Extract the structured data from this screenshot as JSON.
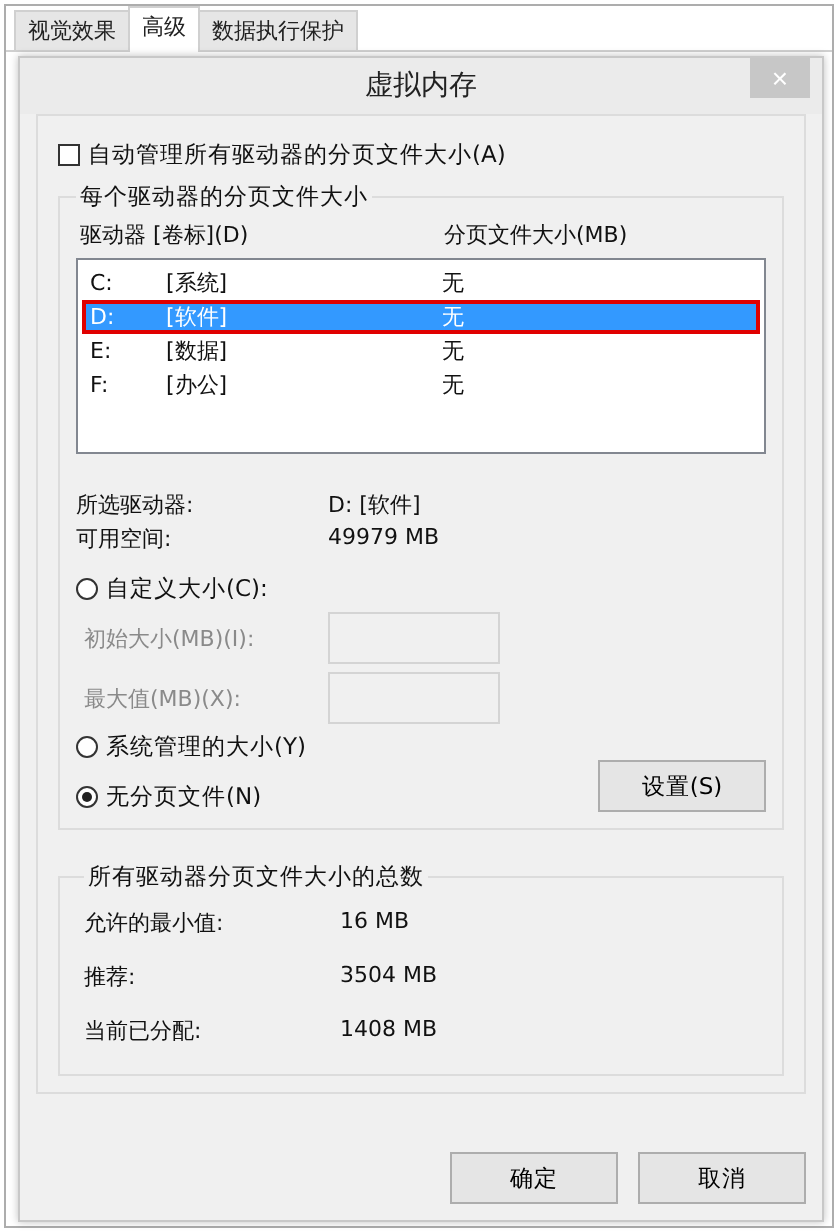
{
  "background_tabs": [
    {
      "label": "视觉效果",
      "selected": false
    },
    {
      "label": "高级",
      "selected": true
    },
    {
      "label": "数据执行保护",
      "selected": false
    }
  ],
  "dialog": {
    "title": "虚拟内存",
    "close": "×"
  },
  "auto_manage": {
    "label": "自动管理所有驱动器的分页文件大小(A)",
    "checked": false
  },
  "per_drive": {
    "title": "每个驱动器的分页文件大小",
    "columns": [
      "驱动器 [卷标](D)",
      "分页文件大小(MB)"
    ],
    "rows": [
      {
        "drive": "C:",
        "volume": "[系统]",
        "size": "无",
        "selected": false,
        "outlined": false
      },
      {
        "drive": "D:",
        "volume": "[软件]",
        "size": "无",
        "selected": true,
        "outlined": true
      },
      {
        "drive": "E:",
        "volume": "[数据]",
        "size": "无",
        "selected": false,
        "outlined": false
      },
      {
        "drive": "F:",
        "volume": "[办公]",
        "size": "无",
        "selected": false,
        "outlined": false
      }
    ],
    "info": [
      {
        "label": "所选驱动器:",
        "value": "D:  [软件]"
      },
      {
        "label": "可用空间:",
        "value": "49979 MB"
      }
    ],
    "options": [
      {
        "label": "自定义大小(C):",
        "selected": false
      },
      {
        "label": "系统管理的大小(Y)",
        "selected": false
      },
      {
        "label": "无分页文件(N)",
        "selected": true
      }
    ],
    "fields": [
      {
        "label": "初始大小(MB)(I):",
        "disabled": true
      },
      {
        "label": "最大值(MB)(X):",
        "disabled": true
      }
    ],
    "set_button": "设置(S)"
  },
  "totals": {
    "title": "所有驱动器分页文件大小的总数",
    "rows": [
      {
        "label": "允许的最小值:",
        "value": "16 MB"
      },
      {
        "label": "推荐:",
        "value": "3504 MB"
      },
      {
        "label": "当前已分配:",
        "value": "1408 MB"
      }
    ]
  },
  "buttons": [
    "确定",
    "取消"
  ]
}
